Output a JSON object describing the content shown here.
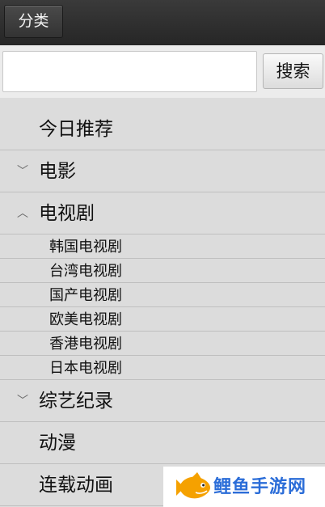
{
  "header": {
    "category_button": "分类"
  },
  "search": {
    "value": "",
    "placeholder": "",
    "button_label": "搜索"
  },
  "menu": {
    "items": [
      {
        "label": "今日推荐",
        "chevron": ""
      },
      {
        "label": "电影",
        "chevron": "﹀"
      },
      {
        "label": "电视剧",
        "chevron": "︿"
      }
    ],
    "tv_subitems": [
      "韩国电视剧",
      "台湾电视剧",
      "国产电视剧",
      "欧美电视剧",
      "香港电视剧",
      "日本电视剧"
    ],
    "items_after": [
      {
        "label": "综艺纪录",
        "chevron": "﹀"
      },
      {
        "label": "动漫",
        "chevron": ""
      },
      {
        "label": "连载动画",
        "chevron": ""
      }
    ]
  },
  "watermark": {
    "text": "鲤鱼手游网",
    "icon": "carp-fish-icon"
  },
  "colors": {
    "topbar": "#2e2e2e",
    "menu_bg": "#dcdcdc",
    "watermark_text": "#2b6dd8",
    "fish": "#f5a100"
  }
}
